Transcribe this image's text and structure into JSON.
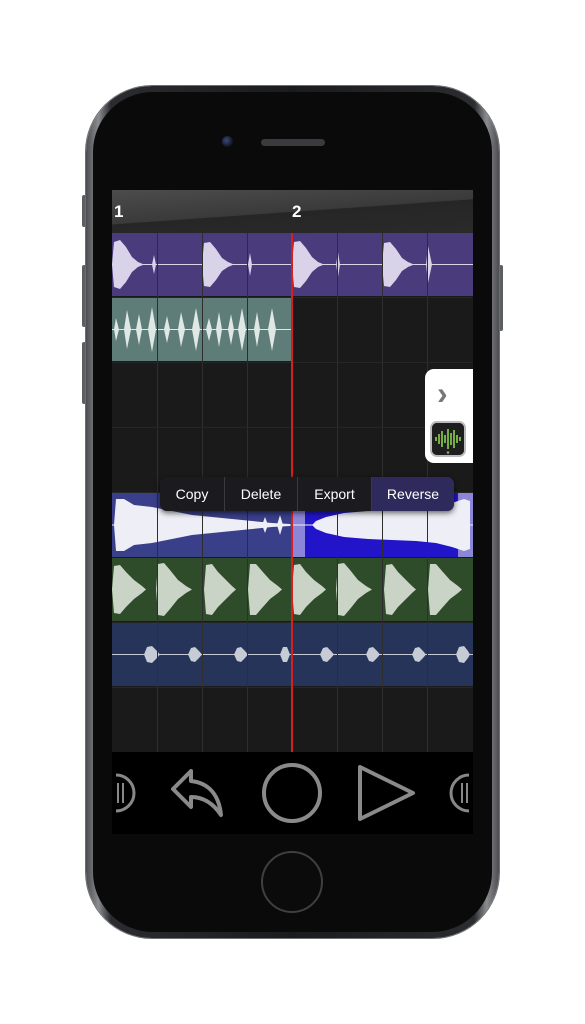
{
  "ruler": {
    "bar_1": "1",
    "bar_2": "2"
  },
  "tracks": [
    {
      "name": "track-purple",
      "color": "#4a3b7c"
    },
    {
      "name": "track-teal",
      "color": "#5f7d78"
    },
    {
      "name": "track-empty-1",
      "color": "#1a1a1a"
    },
    {
      "name": "track-empty-2",
      "color": "#1a1a1a"
    },
    {
      "name": "track-blue-selected",
      "color": "#3a3f8a",
      "selected_color": "#2214c8"
    },
    {
      "name": "track-green",
      "color": "#2f4c2a"
    },
    {
      "name": "track-navy",
      "color": "#263459"
    },
    {
      "name": "track-empty-3",
      "color": "#1a1a1a"
    }
  ],
  "context_menu": {
    "copy": "Copy",
    "delete": "Delete",
    "export": "Export",
    "reverse": "Reverse"
  },
  "side_panel": {
    "chevron": "›",
    "app_icon": "audio-waveform-app-icon"
  },
  "transport": {
    "undo_icon": "undo-icon",
    "record_icon": "record-icon",
    "play_icon": "play-icon"
  },
  "colors": {
    "playhead": "#d61f1f",
    "waveform": "#d8dcd8"
  }
}
